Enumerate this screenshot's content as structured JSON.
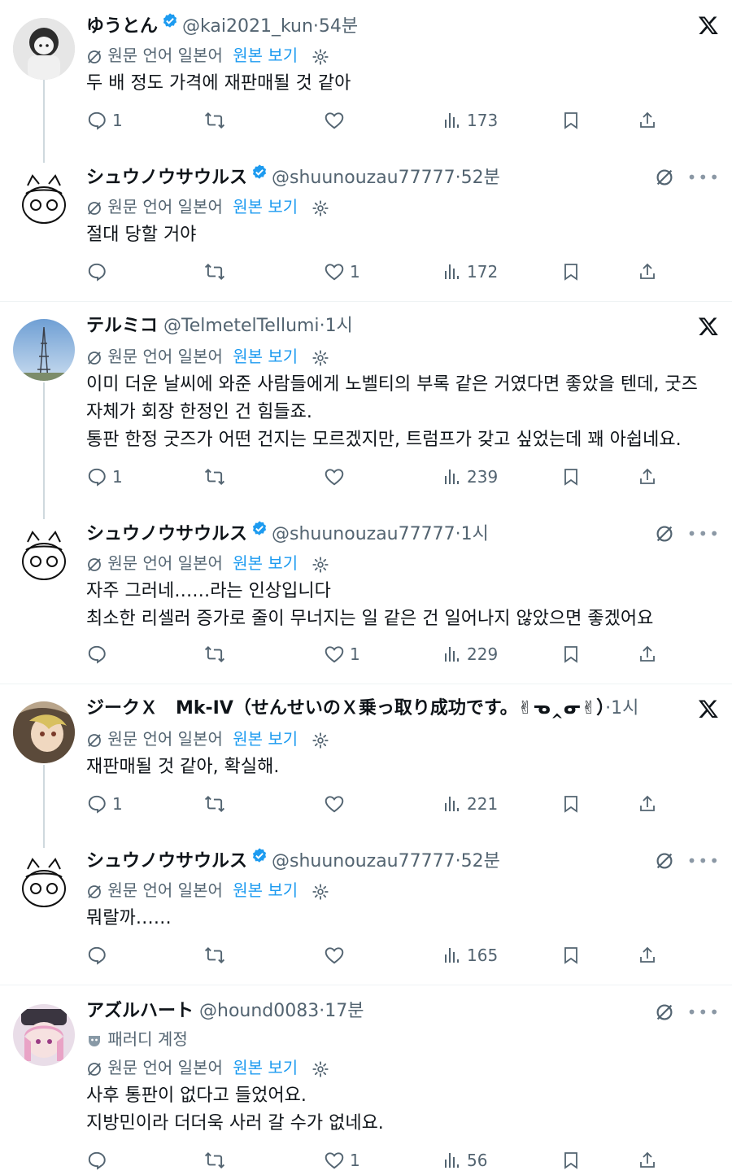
{
  "translate": {
    "label": "원문 언어 일본어",
    "show_original": "원본 보기"
  },
  "tweets": [
    {
      "name": "ゆうとん",
      "handle": "@kai2021_kun",
      "time": "54분",
      "text": [
        "두 배 정도 가격에 재판매될 것 같아"
      ],
      "replies": "1",
      "retweets": "",
      "likes": "",
      "views": "173"
    },
    {
      "name": "シュウノウサウルス",
      "handle": "@shuunouzau77777",
      "time": "52분",
      "text": [
        "절대 당할 거야"
      ],
      "replies": "",
      "retweets": "",
      "likes": "1",
      "views": "172"
    },
    {
      "name": "テルミコ",
      "handle": "@TelmetelTellumi",
      "time": "1시",
      "text": [
        "이미 더운 날씨에 와준 사람들에게 노벨티의 부록 같은 거였다면 좋았을 텐데, 굿즈",
        "자체가 회장 한정인 건 힘들죠.",
        "통판 한정 굿즈가 어떤 건지는 모르겠지만, 트럼프가 갖고 싶었는데 꽤 아쉽네요."
      ],
      "replies": "1",
      "retweets": "",
      "likes": "",
      "views": "239"
    },
    {
      "name": "シュウノウサウルス",
      "handle": "@shuunouzau77777",
      "time": "1시",
      "text": [
        "자주 그러네……라는 인상입니다",
        "최소한 리셀러 증가로 줄이 무너지는 일 같은 건 일어나지 않았으면 좋겠어요"
      ],
      "replies": "",
      "retweets": "",
      "likes": "1",
      "views": "229"
    },
    {
      "name": "ジークＸ　Mk-IV（せんせいのＸ乗っ取り成功です。✌ᓀ‸ᓂ✌）",
      "handle": "",
      "time": "1시",
      "text": [
        "재판매될 것 같아, 확실해."
      ],
      "replies": "1",
      "retweets": "",
      "likes": "",
      "views": "221"
    },
    {
      "name": "シュウノウサウルス",
      "handle": "@shuunouzau77777",
      "time": "52분",
      "text": [
        "뭐랄까……"
      ],
      "replies": "",
      "retweets": "",
      "likes": "",
      "views": "165"
    },
    {
      "name": "アズルハート",
      "handle": "@hound0083",
      "time": "17분",
      "parody": "패러디 계정",
      "text": [
        "사후 통판이 없다고 들었어요.",
        "지방민이라 더더욱 사러 갈 수가 없네요."
      ],
      "replies": "",
      "retweets": "",
      "likes": "1",
      "views": "56"
    }
  ],
  "icons": {
    "verified": "verified-badge-icon",
    "close": "x-logo-icon",
    "translate": "translate-slash-icon",
    "settings": "gear-icon",
    "reply": "reply-icon",
    "retweet": "retweet-icon",
    "like": "heart-icon",
    "views": "views-icon",
    "bookmark": "bookmark-icon",
    "share": "share-icon",
    "more": "more-icon"
  },
  "colors": {
    "accent": "#1d9bf0",
    "secondary_text": "#536471",
    "divider": "#eff3f4"
  }
}
